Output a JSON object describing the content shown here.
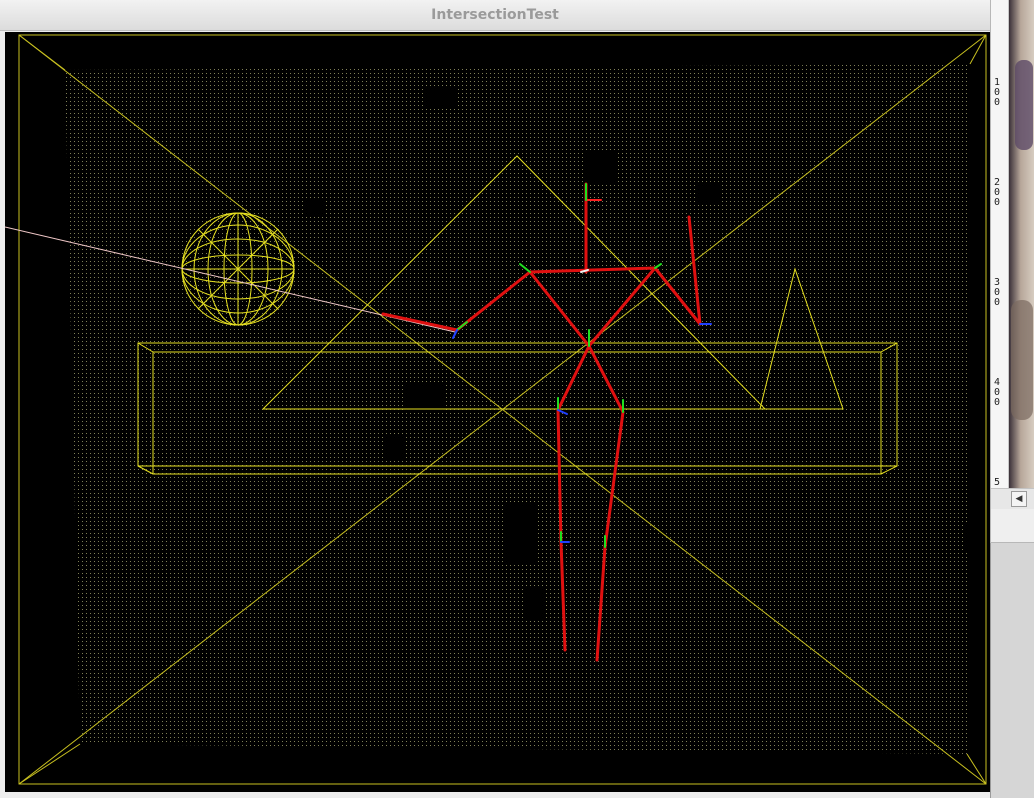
{
  "window": {
    "title": "IntersectionTest"
  },
  "side_panel": {
    "ruler_labels": [
      "100",
      "200",
      "300",
      "400",
      "5"
    ]
  },
  "colors": {
    "background": "#000000",
    "point_cloud": "#e8e8a0",
    "wireframe": "#e6e020",
    "skeleton_bone": "#e01010",
    "joint_axis_x": "#ff2020",
    "joint_axis_y": "#20e020",
    "joint_axis_z": "#2040ff",
    "ray": "#f0c8c8"
  },
  "icons": {
    "scroll_left": "chevron-left-icon"
  }
}
